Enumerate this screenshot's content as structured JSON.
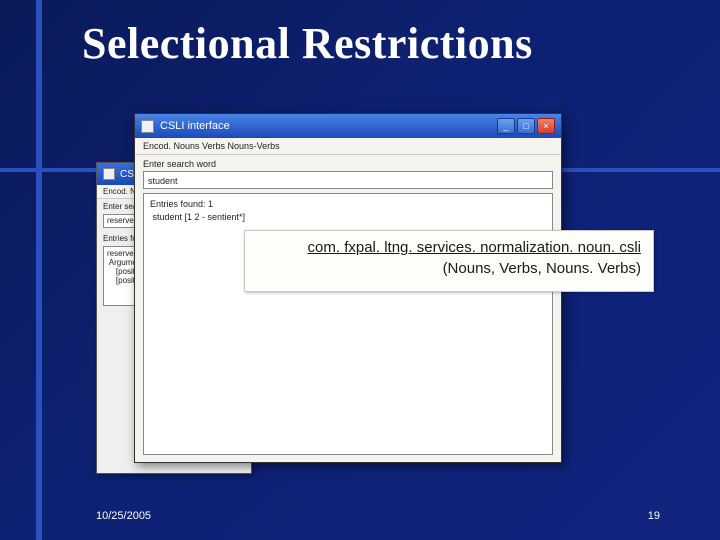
{
  "slide": {
    "title": "Selectional Restrictions",
    "date": "10/25/2005",
    "page_number": "19"
  },
  "callout": {
    "line1": "com. fxpal. ltng. services. normalization. noun. csli",
    "line2": "(Nouns, Verbs, Nouns. Verbs)"
  },
  "win_back": {
    "title": "CSLI in",
    "menu": "Encod.  Nv",
    "search_label": "Enter sea",
    "search_value": "reserve",
    "results_label": "Entries fo",
    "results_body": "reserve\n Argument\n    [posit\n    [posit"
  },
  "win_front": {
    "title": "CSLI interface",
    "menu": "Encod.  Nouns  Verbs  Nouns-Verbs",
    "search_label": "Enter search word",
    "search_value": "student",
    "results_body": "Entries found: 1\n student [1 2 - sentient*]",
    "btn_min": "_",
    "btn_max": "□",
    "btn_close": "×"
  }
}
